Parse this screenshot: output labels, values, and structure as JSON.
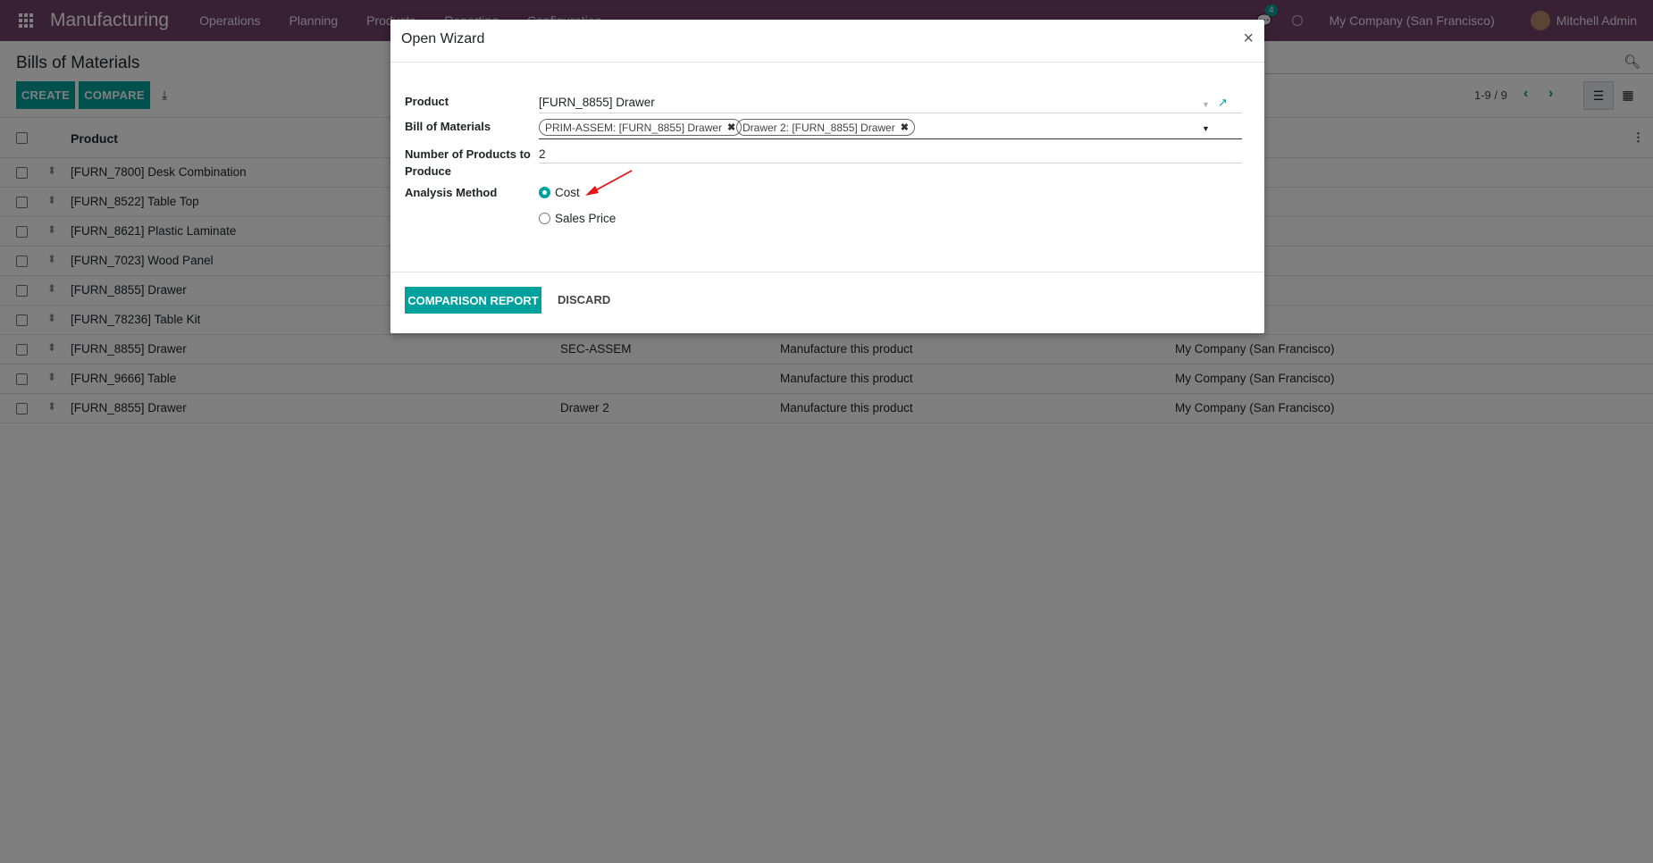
{
  "navbar": {
    "app_name": "Manufacturing",
    "menu": [
      "Operations",
      "Planning",
      "Products",
      "Reporting",
      "Configuration"
    ],
    "message_count": "4",
    "company": "My Company (San Francisco)",
    "user": "Mitchell Admin"
  },
  "control_panel": {
    "title": "Bills of Materials",
    "create_label": "CREATE",
    "compare_label": "COMPARE",
    "pager": "1-9 / 9"
  },
  "list": {
    "header_product": "Product",
    "rows": [
      {
        "product": "[FURN_7800] Desk Combination",
        "ref": "",
        "type": "",
        "company": "an Francisco)"
      },
      {
        "product": "[FURN_8522] Table Top",
        "ref": "",
        "type": "",
        "company": "an Francisco)"
      },
      {
        "product": "[FURN_8621] Plastic Laminate",
        "ref": "",
        "type": "",
        "company": "an Francisco)"
      },
      {
        "product": "[FURN_7023] Wood Panel",
        "ref": "",
        "type": "",
        "company": "an Francisco)"
      },
      {
        "product": "[FURN_8855] Drawer",
        "ref": "",
        "type": "",
        "company": "an Francisco)"
      },
      {
        "product": "[FURN_78236] Table Kit",
        "ref": "",
        "type": "",
        "company": "an Francisco)"
      },
      {
        "product": "[FURN_8855] Drawer",
        "ref": "SEC-ASSEM",
        "type": "Manufacture this product",
        "company": "My Company (San Francisco)"
      },
      {
        "product": "[FURN_9666] Table",
        "ref": "",
        "type": "Manufacture this product",
        "company": "My Company (San Francisco)"
      },
      {
        "product": "[FURN_8855] Drawer",
        "ref": "Drawer 2",
        "type": "Manufacture this product",
        "company": "My Company (San Francisco)"
      }
    ]
  },
  "wizard": {
    "title": "Open Wizard",
    "close_glyph": "×",
    "product_label": "Product",
    "product_value": "[FURN_8855] Drawer",
    "bom_label": "Bill of Materials",
    "bom_tags": [
      "PRIM-ASSEM: [FURN_8855] Drawer",
      "Drawer 2: [FURN_8855] Drawer"
    ],
    "qty_label_1": "Number of Products to",
    "qty_label_2": "Produce",
    "qty_value": "2",
    "method_label": "Analysis Method",
    "method_options": [
      "Cost",
      "Sales Price"
    ],
    "method_selected": "Cost",
    "report_button": "COMPARISON REPORT",
    "discard_button": "DISCARD"
  },
  "colors": {
    "navbar": "#71436a",
    "accent": "#00a09d",
    "annotation_arrow": "#e8141a"
  }
}
